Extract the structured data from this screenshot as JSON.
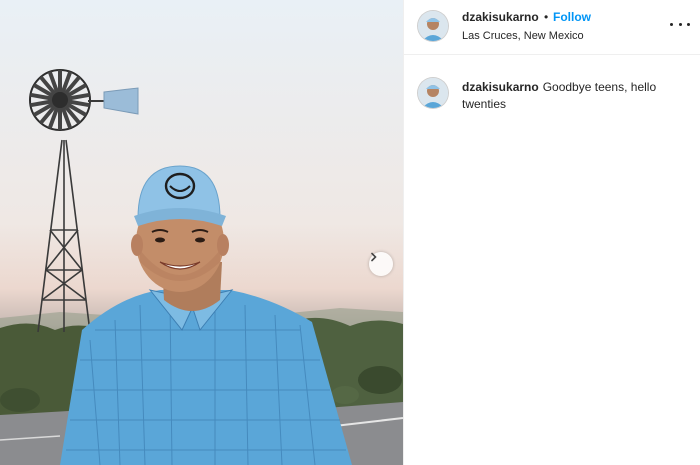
{
  "post": {
    "username": "dzakisukarno",
    "follow_label": "Follow",
    "separator": "•",
    "location": "Las Cruces, New Mexico",
    "more_icon": "more-horizontal-icon",
    "next_icon": "chevron-right-icon"
  },
  "caption": {
    "username": "dzakisukarno",
    "text": "Goodbye teens, hello twenties"
  },
  "colors": {
    "follow_blue": "#0095f6",
    "shirt_blue": "#5aa6d8",
    "cap_blue": "#8fc2e6"
  }
}
